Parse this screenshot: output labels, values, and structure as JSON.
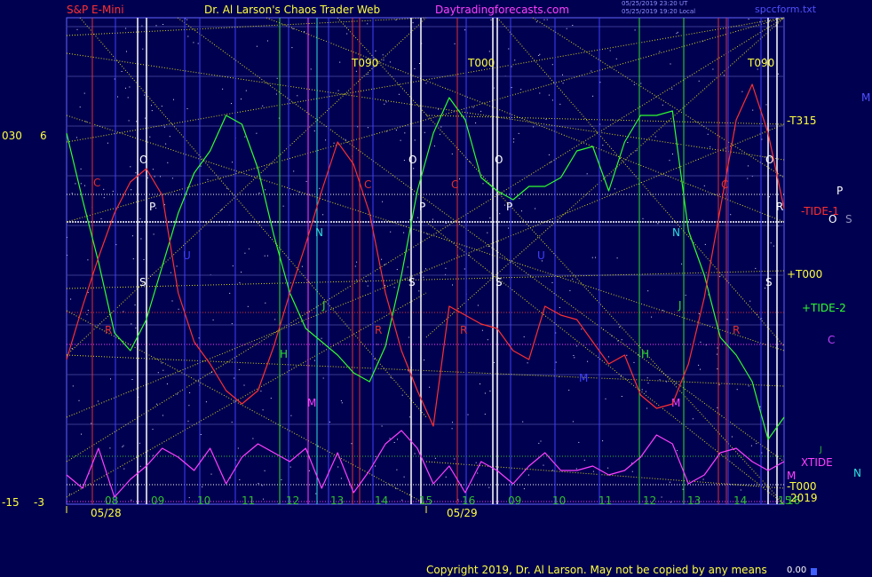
{
  "header": {
    "symbol": "S&P E-Mini",
    "brand": "Dr. Al Larson's Chaos Trader Web",
    "site": "Daytradingforecasts.com",
    "stamp_line1": "05/25/2019 23:20 UT",
    "stamp_line2": "05/25/2019 19:20 Local",
    "file": "spccform.txt"
  },
  "left_scale": {
    "top_a": "030",
    "top_b": "6",
    "bottom_a": "-15",
    "bottom_b": "-3"
  },
  "right_labels": {
    "t315": "-T315",
    "tide1": "-TIDE-1",
    "t000_upper": "+T000",
    "tide2": "+TIDE-2",
    "c": "C",
    "p": "P",
    "o": "O",
    "s": "S",
    "m_top": "M",
    "j": "J",
    "xtide": "XTIDE",
    "n": "N",
    "m_bottom": "M",
    "t000_lower": "-T000",
    "year": "2019"
  },
  "footer": {
    "copyright": "Copyright 2019, Dr. Al Larson. May not be copied by any means",
    "value": "0.00"
  },
  "colors": {
    "background": "#000050",
    "plot_border": "#6464ff",
    "price": "#ff3030",
    "tide": "#30ff30",
    "xtide": "#ff40ff",
    "cycle_lines": "#d8d820",
    "white": "#ffffff"
  },
  "chart_data": {
    "type": "line",
    "title": "S&P E-Mini",
    "x_labels": [
      "08",
      "09",
      "10",
      "11",
      "12",
      "13",
      "14",
      "15",
      "16",
      "09",
      "10",
      "11",
      "12",
      "13",
      "14",
      "15",
      "16"
    ],
    "dates": [
      "05/28",
      "05/29"
    ],
    "vertical_markers": [
      {
        "day": "05/28",
        "kind": "red",
        "label": "C"
      },
      {
        "day": "05/28",
        "kind": "white",
        "label": "O"
      },
      {
        "day": "05/28",
        "kind": "white",
        "label": "P"
      },
      {
        "day": "05/28",
        "kind": "white",
        "label": "S"
      },
      {
        "day": "05/28",
        "kind": "blue",
        "label": "U"
      },
      {
        "day": "05/28",
        "kind": "green",
        "label": "H"
      },
      {
        "day": "05/28",
        "kind": "cyan",
        "label": "N"
      },
      {
        "day": "05/28",
        "kind": "green",
        "label": "J"
      },
      {
        "day": "05/28",
        "kind": "magenta",
        "label": "M"
      },
      {
        "day": "05/28",
        "kind": "red",
        "label": "C"
      },
      {
        "day": "05/28",
        "kind": "red",
        "label": "R"
      },
      {
        "day": "05/29",
        "kind": "white",
        "label": "O"
      },
      {
        "day": "05/29",
        "kind": "white",
        "label": "P"
      },
      {
        "day": "05/29",
        "kind": "white",
        "label": "S"
      },
      {
        "day": "05/29",
        "kind": "red",
        "label": "C"
      },
      {
        "day": "05/29",
        "kind": "red",
        "label": "R"
      },
      {
        "day": "05/29",
        "kind": "white",
        "label": "O"
      },
      {
        "day": "05/29",
        "kind": "white",
        "label": "P"
      },
      {
        "day": "05/29",
        "kind": "white",
        "label": "S"
      },
      {
        "day": "05/29",
        "kind": "blue",
        "label": "U"
      },
      {
        "day": "05/29",
        "kind": "blue",
        "label": "M"
      },
      {
        "day": "05/29",
        "kind": "green",
        "label": "H"
      },
      {
        "day": "05/29",
        "kind": "cyan",
        "label": "N"
      },
      {
        "day": "05/29",
        "kind": "green",
        "label": "J"
      },
      {
        "day": "05/29",
        "kind": "magenta",
        "label": "M"
      },
      {
        "day": "05/29",
        "kind": "red",
        "label": "C"
      },
      {
        "day": "05/29",
        "kind": "red",
        "label": "R"
      },
      {
        "day": "05/29",
        "kind": "white",
        "label": "O"
      },
      {
        "day": "05/29",
        "kind": "white",
        "label": "R"
      },
      {
        "day": "05/29",
        "kind": "white",
        "label": "S"
      }
    ],
    "top_markers": [
      "T090",
      "T000",
      "T090"
    ],
    "series": [
      {
        "name": "TIDE",
        "color": "#30ff30",
        "values": [
          150,
          225,
          295,
          375,
          395,
          360,
          300,
          240,
          195,
          170,
          130,
          140,
          190,
          265,
          330,
          370,
          385,
          400,
          420,
          430,
          390,
          310,
          215,
          150,
          110,
          135,
          200,
          215,
          225,
          210,
          210,
          200,
          170,
          165,
          215,
          160,
          130,
          130,
          125,
          260,
          310,
          380,
          400,
          430,
          495,
          470
        ]
      },
      {
        "name": "Price",
        "color": "#ff3030",
        "values": [
          405,
          345,
          290,
          240,
          205,
          190,
          220,
          330,
          385,
          410,
          440,
          455,
          440,
          390,
          330,
          275,
          215,
          160,
          185,
          240,
          330,
          395,
          440,
          480,
          345,
          355,
          365,
          370,
          395,
          405,
          345,
          355,
          360,
          385,
          410,
          400,
          445,
          460,
          455,
          410,
          335,
          235,
          135,
          95,
          150,
          235
        ]
      },
      {
        "name": "XTIDE",
        "color": "#ff40ff",
        "values": [
          535,
          550,
          505,
          560,
          540,
          525,
          505,
          515,
          530,
          505,
          545,
          515,
          500,
          510,
          520,
          505,
          550,
          510,
          555,
          530,
          500,
          485,
          505,
          545,
          525,
          555,
          520,
          530,
          545,
          525,
          510,
          530,
          530,
          525,
          535,
          530,
          515,
          490,
          500,
          545,
          535,
          510,
          505,
          520,
          530,
          520
        ]
      }
    ]
  }
}
